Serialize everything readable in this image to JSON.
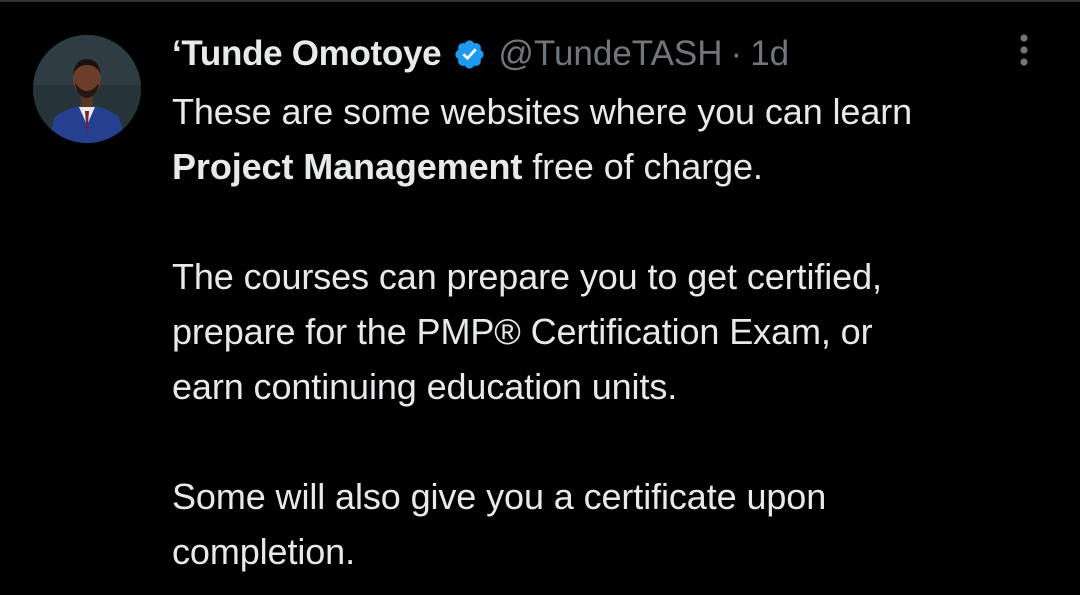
{
  "tweet": {
    "author": {
      "display_name": "‘Tunde Omotoye",
      "handle": "@TundeTASH",
      "verified": true,
      "avatar_icon": "profile-photo"
    },
    "separator": "·",
    "time": "1d",
    "more_icon": "more-options-icon",
    "body": {
      "line1": "These are some websites where you can learn",
      "bold_phrase": "Project Management",
      "line2_rest": " free of charge.",
      "paragraph2": [
        "The courses can prepare you to get certified,",
        "prepare for the PMP® Certification Exam, or",
        "earn continuing education units."
      ],
      "paragraph3": [
        "Some will also give you a certificate upon",
        "completion."
      ]
    }
  },
  "colors": {
    "background": "#000000",
    "text_primary": "#e7e9ea",
    "text_secondary": "#71767b",
    "verified_blue": "#1d9bf0"
  }
}
